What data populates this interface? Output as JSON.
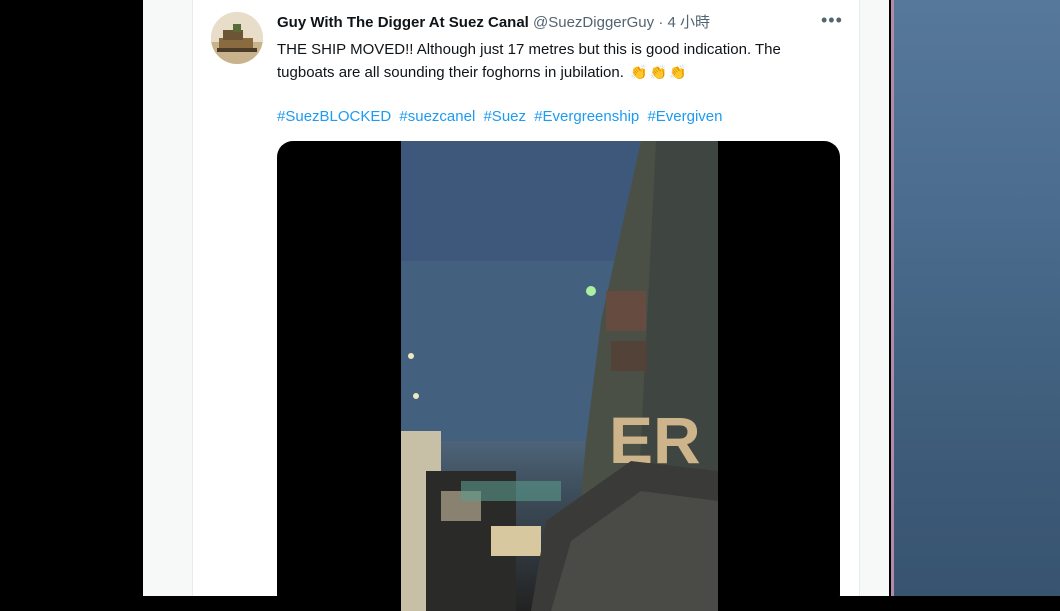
{
  "tweet": {
    "display_name": "Guy With The Digger At Suez Canal",
    "handle": "@SuezDiggerGuy",
    "separator": "·",
    "time": "4 小時",
    "more_icon": "more-horizontal-icon",
    "text": "THE SHIP MOVED!! Although just 17 metres but this is good indication. The tugboats are all sounding their foghorns in jubilation.",
    "emoji": [
      "👏",
      "👏",
      "👏"
    ],
    "hashtags": [
      "#SuezBLOCKED",
      "#suezcanel",
      "#Suez",
      "#Evergreenship",
      "#Evergiven"
    ]
  },
  "media": {
    "visible_text": "ER"
  },
  "colors": {
    "link": "#1d9bf0",
    "text": "#0f1419",
    "secondary": "#536471"
  }
}
